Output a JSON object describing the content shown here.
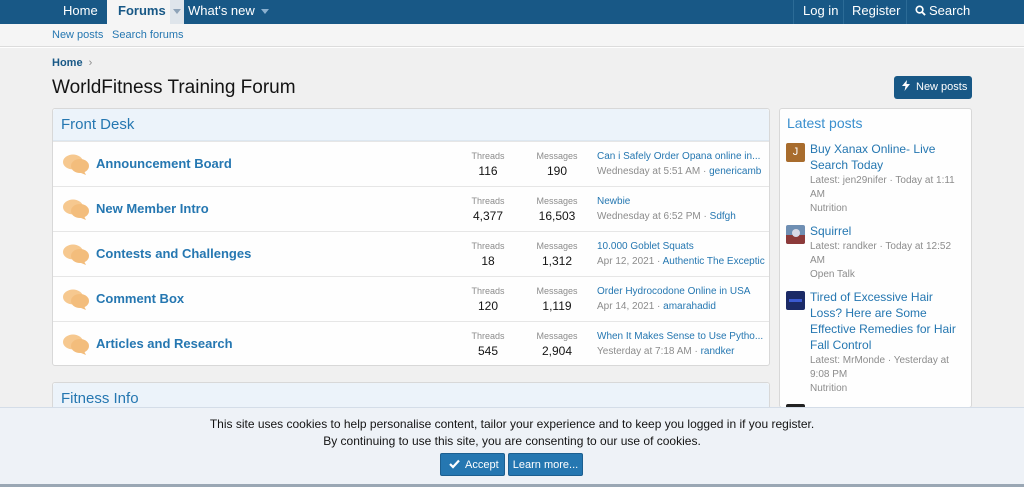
{
  "nav": {
    "home": "Home",
    "forums": "Forums",
    "whats_new": "What's new",
    "login": "Log in",
    "register": "Register",
    "search": "Search"
  },
  "subnav": {
    "new_posts": "New posts",
    "search_forums": "Search forums"
  },
  "breadcrumb": {
    "home": "Home",
    "chevron": "›"
  },
  "page": {
    "title": "WorldFitness Training Forum",
    "new_posts_button": "New posts"
  },
  "front_desk": {
    "title": "Front Desk",
    "threads_label": "Threads",
    "messages_label": "Messages",
    "nodes": [
      {
        "title": "Announcement Board",
        "threads": "116",
        "messages": "190",
        "latest_title": "Can i Safely Order Opana online in...",
        "latest_time": "Wednesday at 5:51 AM",
        "latest_user": "genericamb"
      },
      {
        "title": "New Member Intro",
        "threads": "4,377",
        "messages": "16,503",
        "latest_title": "Newbie",
        "latest_time": "Wednesday at 6:52 PM",
        "latest_user": "Sdfgh"
      },
      {
        "title": "Contests and Challenges",
        "threads": "18",
        "messages": "1,312",
        "latest_title": "10.000 Goblet Squats",
        "latest_time": "Apr 12, 2021",
        "latest_user": "Authentic The Exceptic"
      },
      {
        "title": "Comment Box",
        "threads": "120",
        "messages": "1,119",
        "latest_title": "Order Hydrocodone Online in USA",
        "latest_time": "Apr 14, 2021",
        "latest_user": "amarahadid"
      },
      {
        "title": "Articles and Research",
        "threads": "545",
        "messages": "2,904",
        "latest_title": "When It Makes Sense to Use Pytho...",
        "latest_time": "Yesterday at 7:18 AM",
        "latest_user": "randker"
      }
    ]
  },
  "fitness_info": {
    "title": "Fitness Info"
  },
  "sidebar": {
    "title": "Latest posts",
    "posts": [
      {
        "avatar_letter": "J",
        "title": "Buy Xanax Online- Live Search Today",
        "meta": "Latest: jen29nifer · Today at 1:11 AM",
        "forum": "Nutrition"
      },
      {
        "avatar_letter": "",
        "title": "Squirrel",
        "meta": "Latest: randker · Today at 12:52 AM",
        "forum": "Open Talk"
      },
      {
        "avatar_letter": "",
        "title": "Tired of Excessive Hair Loss? Here are Some Effective Remedies for Hair Fall Control",
        "meta": "Latest: MrMonde · Yesterday at 9:08 PM",
        "forum": "Nutrition"
      }
    ]
  },
  "cookie": {
    "line1": "This site uses cookies to help personalise content, tailor your experience and to keep you logged in if you register.",
    "line2": "By continuing to use this site, you are consenting to our use of cookies.",
    "accept": "Accept",
    "learn_more": "Learn more..."
  },
  "colors": {
    "nav_bg": "#185886",
    "link": "#2577b1",
    "bubble": "#f6c88f"
  }
}
